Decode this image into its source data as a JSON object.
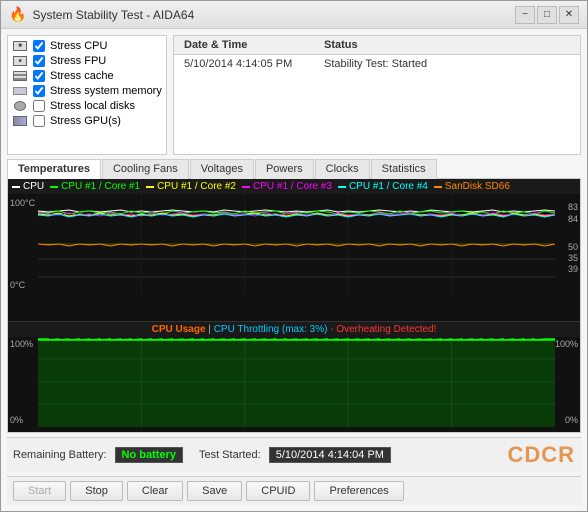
{
  "window": {
    "title": "System Stability Test - AIDA64",
    "icon": "🔥",
    "min_btn": "−",
    "max_btn": "□",
    "close_btn": "✕"
  },
  "stress_options": [
    {
      "id": "cpu",
      "label": "Stress CPU",
      "checked": true,
      "icon": "cpu"
    },
    {
      "id": "fpu",
      "label": "Stress FPU",
      "checked": true,
      "icon": "fpu"
    },
    {
      "id": "cache",
      "label": "Stress cache",
      "checked": true,
      "icon": "cache"
    },
    {
      "id": "memory",
      "label": "Stress system memory",
      "checked": true,
      "icon": "mem"
    },
    {
      "id": "disk",
      "label": "Stress local disks",
      "checked": false,
      "icon": "disk"
    },
    {
      "id": "gpu",
      "label": "Stress GPU(s)",
      "checked": false,
      "icon": "gpu"
    }
  ],
  "log": {
    "headers": [
      "Date & Time",
      "Status"
    ],
    "rows": [
      {
        "datetime": "5/10/2014 4:14:05 PM",
        "status": "Stability Test: Started"
      }
    ]
  },
  "tabs": [
    {
      "id": "temperatures",
      "label": "Temperatures",
      "active": true
    },
    {
      "id": "cooling-fans",
      "label": "Cooling Fans",
      "active": false
    },
    {
      "id": "voltages",
      "label": "Voltages",
      "active": false
    },
    {
      "id": "powers",
      "label": "Powers",
      "active": false
    },
    {
      "id": "clocks",
      "label": "Clocks",
      "active": false
    },
    {
      "id": "statistics",
      "label": "Statistics",
      "active": false
    }
  ],
  "temp_chart": {
    "legend": [
      {
        "label": "CPU",
        "color": "#ffffff"
      },
      {
        "label": "CPU #1 / Core #1",
        "color": "#00ff00"
      },
      {
        "label": "CPU #1 / Core #2",
        "color": "#ffff00"
      },
      {
        "label": "CPU #1 / Core #3",
        "color": "#ff00ff"
      },
      {
        "label": "CPU #1 / Core #4",
        "color": "#00ffff"
      },
      {
        "label": "SanDisk SD66",
        "color": "#ff8800"
      }
    ],
    "y_labels_left": [
      "100°C",
      "0°C"
    ],
    "y_labels_right": [
      "83",
      "84",
      "50",
      "35",
      "39"
    ]
  },
  "usage_chart": {
    "title_cpu": "CPU Usage",
    "title_sep": " | ",
    "title_throttle": "CPU Throttling (max: 3%)",
    "title_alert": " - Overheating Detected!",
    "y_label_left_top": "100%",
    "y_label_left_bottom": "0%",
    "y_label_right_top": "100%",
    "y_label_right_bottom": "0%"
  },
  "bottom": {
    "battery_label": "Remaining Battery:",
    "battery_value": "No battery",
    "test_label": "Test Started:",
    "test_value": "5/10/2014 4:14:04 PM",
    "watermark": "CDCR"
  },
  "actions": {
    "start": "Start",
    "stop": "Stop",
    "clear": "Clear",
    "save": "Save",
    "cpuid": "CPUID",
    "preferences": "Preferences"
  }
}
